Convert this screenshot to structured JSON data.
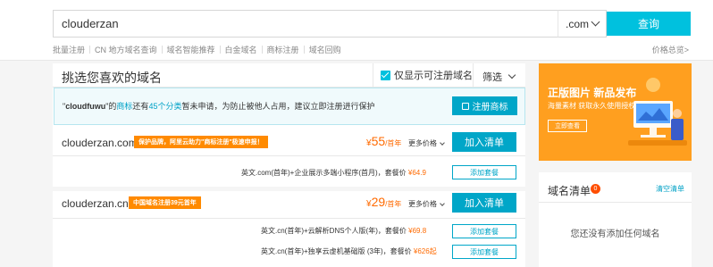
{
  "search": {
    "value": "clouderzan",
    "placeholder": ""
  },
  "suffix_select": {
    "selected": ".com"
  },
  "search_button": "查询",
  "subnav": [
    "批量注册",
    "CN 地方域名查询",
    "域名智能推荐",
    "白金域名",
    "商标注册",
    "域名回购"
  ],
  "price_overview": "价格总览>",
  "main": {
    "title": "挑选您喜欢的域名",
    "only_available_label": "仅显示可注册域名",
    "filter_label": "筛选"
  },
  "trademark": {
    "quote_open": "\"",
    "brand": "cloudfuwu",
    "text_1": "\"的",
    "link_1": "商标",
    "text_2": "还有",
    "link_2": "45个分类",
    "text_3": "暂未申请，为防止被他人占用，建议立即注册进行保护",
    "button": "注册商标"
  },
  "results": [
    {
      "domain": "clouderzan.com",
      "promo": "保护品牌，阿里云助力\"商标注册\"极速申报！",
      "currency": "¥",
      "price": "55",
      "unit": "/首年",
      "more_price": "更多价格",
      "add_button": "加入清单",
      "bundles": [
        {
          "text": "英文.com(首年)+企业展示多端小程序(首月)，套餐价",
          "price": "¥64.9",
          "button": "添加套餐"
        }
      ]
    },
    {
      "domain": "clouderzan.cn",
      "promo": "中国域名注册39元首年",
      "currency": "¥",
      "price": "29",
      "unit": "/首年",
      "more_price": "更多价格",
      "add_button": "加入清单",
      "bundles": [
        {
          "text": "英文.cn(首年)+云解析DNS个人版(年)，套餐价",
          "price": "¥69.8",
          "button": "添加套餐"
        },
        {
          "text": "英文.cn(首年)+独享云虚机基础版 (3年)，套餐价",
          "price": "¥626起",
          "button": "添加套餐"
        }
      ]
    }
  ],
  "ad": {
    "title": "正版图片  新品发布",
    "subtitle": "海量素材 获取永久使用授权",
    "button": "立即查看"
  },
  "cart": {
    "title": "域名清单",
    "count": "0",
    "clear": "清空清单",
    "empty": "您还没有添加任何域名"
  },
  "colors": {
    "accent": "#00c1de",
    "button": "#00a6c8",
    "price": "#ff6a00",
    "promo": "#ff8a00",
    "ad_bg": "#ff9f1f"
  }
}
